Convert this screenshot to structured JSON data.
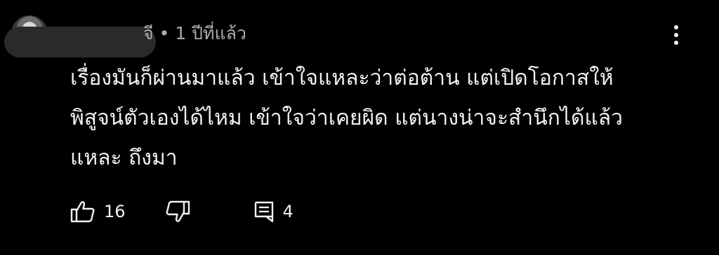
{
  "comment": {
    "meta_text": "จี • 1 ปีที่แล้ว",
    "text": "เรื่องมันก็ผ่านมาแล้ว เข้าใจแหละว่าต่อต้าน แต่เปิดโอกาสให้\nพิสูจน์ตัวเองได้ไหม เข้าใจว่าเคยผิด แต่นางน่าจะสำนึกได้แล้ว\nแหละ ถึงมา",
    "likes": "16",
    "replies": "4"
  },
  "icons": {
    "like": "thumbs-up-icon",
    "dislike": "thumbs-down-icon",
    "reply": "reply-icon",
    "menu": "more-vert-icon"
  },
  "colors": {
    "background": "#000000",
    "text": "#f1f1f1",
    "secondary_text": "#aaaaaa"
  }
}
